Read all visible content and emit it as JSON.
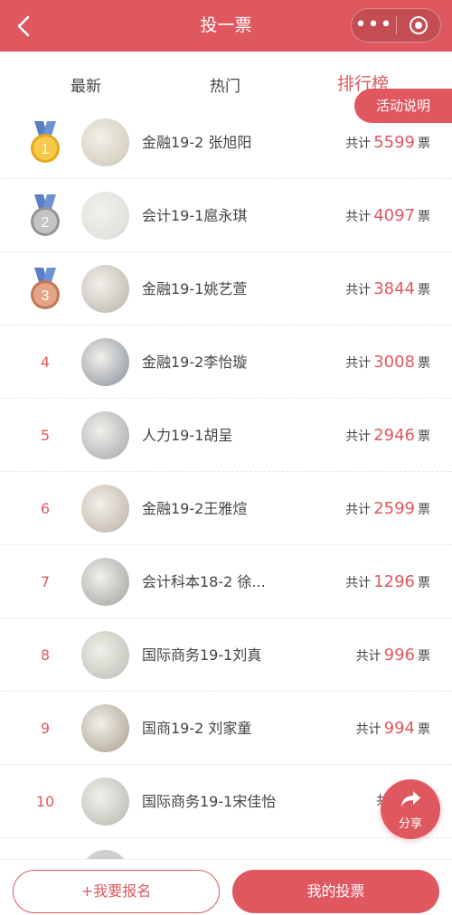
{
  "header": {
    "title": "投一票",
    "more_icon": "more-dots-icon",
    "close_icon": "target-close-icon",
    "brand_color": "#e0585f"
  },
  "tabs": [
    "最新",
    "热门",
    "排行榜"
  ],
  "activity_button": "活动说明",
  "votes_prefix": "共计",
  "votes_suffix": "票",
  "rankings": [
    {
      "rank": "1",
      "medal": "gold",
      "name": "金融19-2 张旭阳",
      "votes": "5599"
    },
    {
      "rank": "2",
      "medal": "silver",
      "name": "会计19-1扈永琪",
      "votes": "4097"
    },
    {
      "rank": "3",
      "medal": "bronze",
      "name": "金融19-1姚艺萱",
      "votes": "3844"
    },
    {
      "rank": "4",
      "medal": "",
      "name": "金融19-2李怡璇",
      "votes": "3008"
    },
    {
      "rank": "5",
      "medal": "",
      "name": "人力19-1胡呈",
      "votes": "2946"
    },
    {
      "rank": "6",
      "medal": "",
      "name": "金融19-2王雅煊",
      "votes": "2599"
    },
    {
      "rank": "7",
      "medal": "",
      "name": "会计科本18-2 徐...",
      "votes": "1296"
    },
    {
      "rank": "8",
      "medal": "",
      "name": "国际商务19-1刘真",
      "votes": "996"
    },
    {
      "rank": "9",
      "medal": "",
      "name": "国商19-2 刘家童",
      "votes": "994"
    },
    {
      "rank": "10",
      "medal": "",
      "name": "国际商务19-1宋佳怡",
      "votes": ""
    }
  ],
  "share_label": "分享",
  "bottom": {
    "signup": "+我要报名",
    "my_votes": "我的投票"
  }
}
